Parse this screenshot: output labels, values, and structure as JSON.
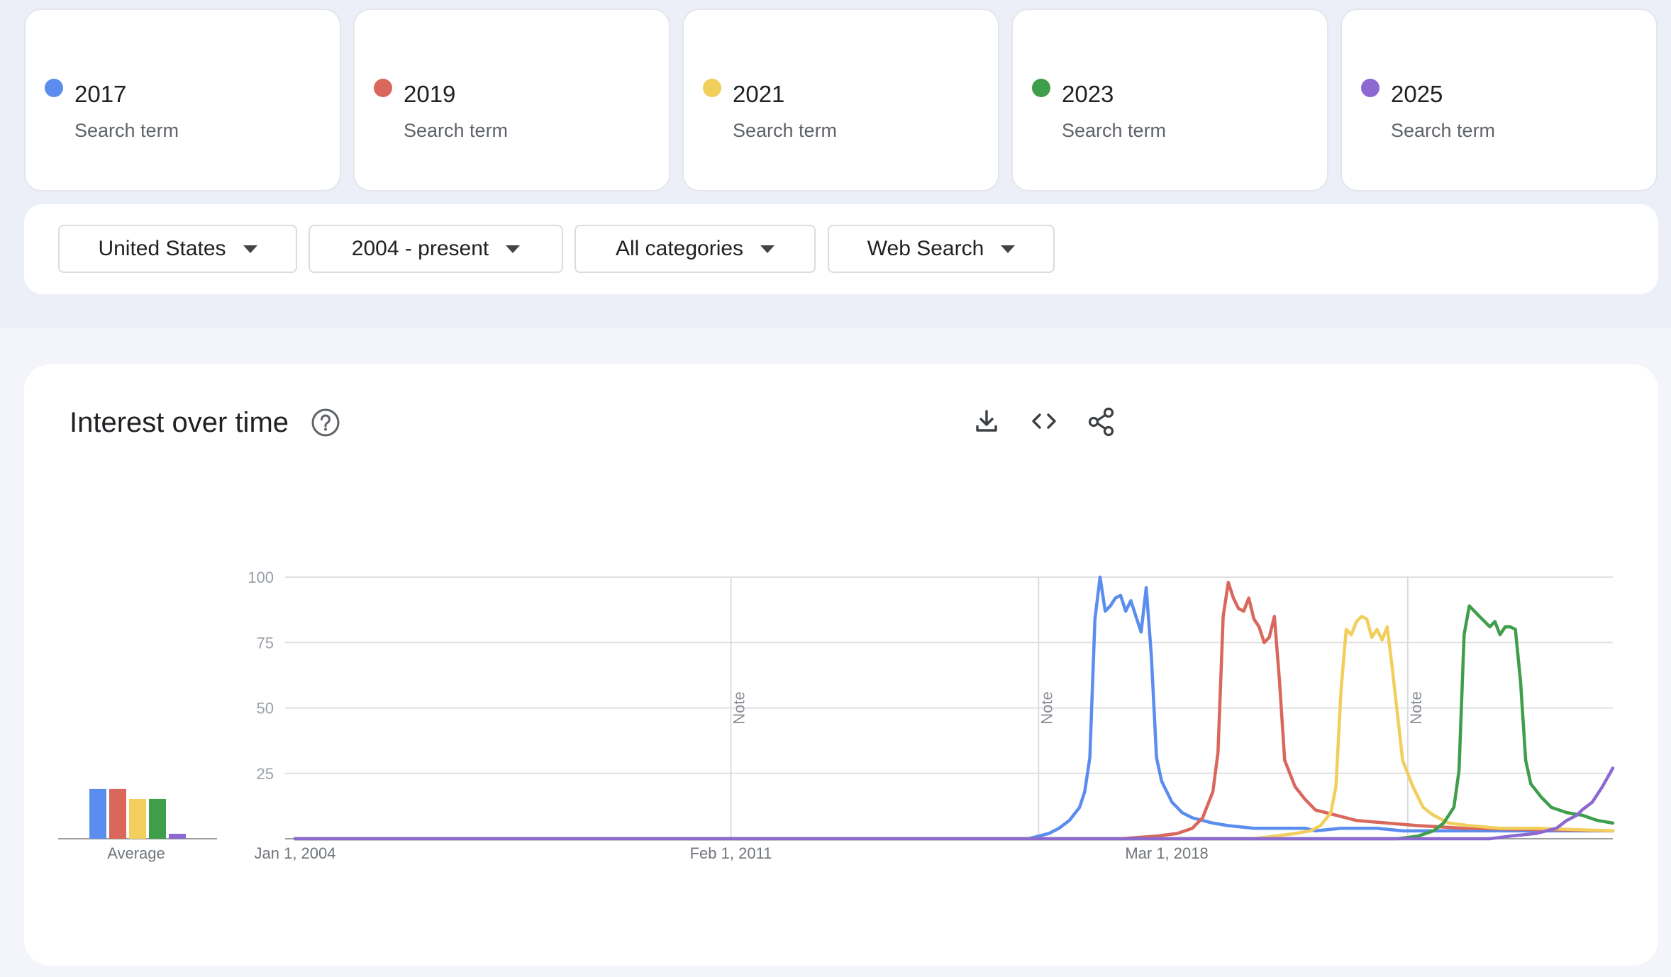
{
  "terms": [
    {
      "name": "2017",
      "subtitle": "Search term",
      "color": "#5B8DEF"
    },
    {
      "name": "2019",
      "subtitle": "Search term",
      "color": "#D9675C"
    },
    {
      "name": "2021",
      "subtitle": "Search term",
      "color": "#F2CE5C"
    },
    {
      "name": "2023",
      "subtitle": "Search term",
      "color": "#3F9E4A"
    },
    {
      "name": "2025",
      "subtitle": "Search term",
      "color": "#8C68D1"
    }
  ],
  "filters": {
    "region": "United States",
    "time_range": "2004 - present",
    "category": "All categories",
    "search_type": "Web Search"
  },
  "panel": {
    "title": "Interest over time",
    "icons": [
      "help-icon",
      "download-icon",
      "embed-code-icon",
      "share-icon"
    ]
  },
  "chart_data": {
    "type": "line",
    "title": "Interest over time",
    "ylim": [
      0,
      100
    ],
    "y_ticks": [
      "100",
      "75",
      "50",
      "25"
    ],
    "x_ticks": [
      {
        "label": "Jan 1, 2004",
        "date": "2004-01"
      },
      {
        "label": "Feb 1, 2011",
        "date": "2011-02"
      },
      {
        "label": "Mar 1, 2018",
        "date": "2018-03"
      }
    ],
    "x_range": [
      "2004-01",
      "2025-06"
    ],
    "notes": [
      {
        "label": "Note",
        "date": "2011-02"
      },
      {
        "label": "Note",
        "date": "2016-02"
      },
      {
        "label": "Note",
        "date": "2022-02"
      }
    ],
    "average": {
      "label": "Average",
      "values": [
        5,
        5,
        4,
        4,
        0.5
      ]
    },
    "series": [
      {
        "name": "2017",
        "color": "#5B8DEF",
        "points": [
          [
            "2004-01",
            0
          ],
          [
            "2015-12",
            0
          ],
          [
            "2016-02",
            1
          ],
          [
            "2016-04",
            2
          ],
          [
            "2016-06",
            4
          ],
          [
            "2016-08",
            7
          ],
          [
            "2016-10",
            12
          ],
          [
            "2016-11",
            18
          ],
          [
            "2016-12",
            31
          ],
          [
            "2017-01",
            84
          ],
          [
            "2017-02",
            100
          ],
          [
            "2017-03",
            87
          ],
          [
            "2017-04",
            89
          ],
          [
            "2017-05",
            92
          ],
          [
            "2017-06",
            93
          ],
          [
            "2017-07",
            87
          ],
          [
            "2017-08",
            91
          ],
          [
            "2017-09",
            85
          ],
          [
            "2017-10",
            79
          ],
          [
            "2017-11",
            96
          ],
          [
            "2017-12",
            70
          ],
          [
            "2018-01",
            31
          ],
          [
            "2018-02",
            22
          ],
          [
            "2018-04",
            14
          ],
          [
            "2018-06",
            10
          ],
          [
            "2018-08",
            8
          ],
          [
            "2018-10",
            7
          ],
          [
            "2018-12",
            6
          ],
          [
            "2019-03",
            5
          ],
          [
            "2019-08",
            4
          ],
          [
            "2020-06",
            4
          ],
          [
            "2020-08",
            3
          ],
          [
            "2021-01",
            4
          ],
          [
            "2021-08",
            4
          ],
          [
            "2022-01",
            3
          ],
          [
            "2025-06",
            3
          ]
        ]
      },
      {
        "name": "2019",
        "color": "#D9675C",
        "points": [
          [
            "2004-01",
            0
          ],
          [
            "2017-06",
            0
          ],
          [
            "2018-01",
            1
          ],
          [
            "2018-05",
            2
          ],
          [
            "2018-08",
            4
          ],
          [
            "2018-10",
            8
          ],
          [
            "2018-12",
            18
          ],
          [
            "2019-01",
            33
          ],
          [
            "2019-02",
            85
          ],
          [
            "2019-03",
            98
          ],
          [
            "2019-04",
            92
          ],
          [
            "2019-05",
            88
          ],
          [
            "2019-06",
            87
          ],
          [
            "2019-07",
            92
          ],
          [
            "2019-08",
            84
          ],
          [
            "2019-09",
            81
          ],
          [
            "2019-10",
            75
          ],
          [
            "2019-11",
            77
          ],
          [
            "2019-12",
            85
          ],
          [
            "2020-01",
            60
          ],
          [
            "2020-02",
            30
          ],
          [
            "2020-04",
            20
          ],
          [
            "2020-06",
            15
          ],
          [
            "2020-08",
            11
          ],
          [
            "2020-12",
            9
          ],
          [
            "2021-04",
            7
          ],
          [
            "2021-10",
            6
          ],
          [
            "2022-04",
            5
          ],
          [
            "2023-01",
            4
          ],
          [
            "2025-06",
            3
          ]
        ]
      },
      {
        "name": "2021",
        "color": "#F2CE5C",
        "points": [
          [
            "2004-01",
            0
          ],
          [
            "2019-08",
            0
          ],
          [
            "2019-12",
            1
          ],
          [
            "2020-04",
            2
          ],
          [
            "2020-07",
            3
          ],
          [
            "2020-09",
            5
          ],
          [
            "2020-11",
            10
          ],
          [
            "2020-12",
            20
          ],
          [
            "2021-01",
            57
          ],
          [
            "2021-02",
            80
          ],
          [
            "2021-03",
            78
          ],
          [
            "2021-04",
            83
          ],
          [
            "2021-05",
            85
          ],
          [
            "2021-06",
            84
          ],
          [
            "2021-07",
            77
          ],
          [
            "2021-08",
            80
          ],
          [
            "2021-09",
            76
          ],
          [
            "2021-10",
            81
          ],
          [
            "2021-11",
            65
          ],
          [
            "2022-01",
            30
          ],
          [
            "2022-03",
            20
          ],
          [
            "2022-05",
            12
          ],
          [
            "2022-07",
            9
          ],
          [
            "2022-10",
            6
          ],
          [
            "2023-02",
            5
          ],
          [
            "2023-08",
            4
          ],
          [
            "2024-03",
            4
          ],
          [
            "2025-06",
            3
          ]
        ]
      },
      {
        "name": "2023",
        "color": "#3F9E4A",
        "points": [
          [
            "2004-01",
            0
          ],
          [
            "2021-12",
            0
          ],
          [
            "2022-04",
            1
          ],
          [
            "2022-07",
            3
          ],
          [
            "2022-09",
            6
          ],
          [
            "2022-11",
            12
          ],
          [
            "2022-12",
            26
          ],
          [
            "2023-01",
            78
          ],
          [
            "2023-02",
            89
          ],
          [
            "2023-03",
            87
          ],
          [
            "2023-04",
            85
          ],
          [
            "2023-05",
            83
          ],
          [
            "2023-06",
            81
          ],
          [
            "2023-07",
            83
          ],
          [
            "2023-08",
            78
          ],
          [
            "2023-09",
            81
          ],
          [
            "2023-10",
            81
          ],
          [
            "2023-11",
            80
          ],
          [
            "2023-12",
            60
          ],
          [
            "2024-01",
            30
          ],
          [
            "2024-02",
            21
          ],
          [
            "2024-04",
            16
          ],
          [
            "2024-06",
            12
          ],
          [
            "2024-09",
            10
          ],
          [
            "2024-12",
            9
          ],
          [
            "2025-03",
            7
          ],
          [
            "2025-06",
            6
          ]
        ]
      },
      {
        "name": "2025",
        "color": "#8C68D1",
        "points": [
          [
            "2004-01",
            0
          ],
          [
            "2023-06",
            0
          ],
          [
            "2023-10",
            1
          ],
          [
            "2024-03",
            2
          ],
          [
            "2024-05",
            3
          ],
          [
            "2024-07",
            4
          ],
          [
            "2024-09",
            7
          ],
          [
            "2024-11",
            9
          ],
          [
            "2024-12",
            11
          ],
          [
            "2025-02",
            14
          ],
          [
            "2025-04",
            20
          ],
          [
            "2025-06",
            27
          ]
        ]
      }
    ]
  }
}
